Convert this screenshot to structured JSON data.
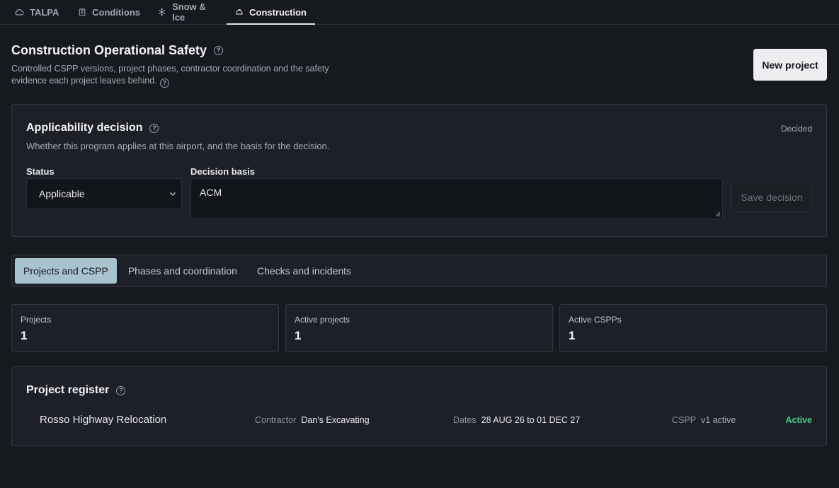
{
  "nav": {
    "tabs": [
      {
        "label": "TALPA",
        "icon": "cloud-icon"
      },
      {
        "label": "Conditions",
        "icon": "clipboard-icon"
      },
      {
        "label": "Snow & Ice",
        "icon": "snowflake-icon"
      },
      {
        "label": "Construction",
        "icon": "hardhat-icon",
        "active": true
      }
    ]
  },
  "header": {
    "title": "Construction Operational Safety",
    "description": "Controlled CSPP versions, project phases, contractor coordination and the safety evidence each project leaves behind.",
    "new_project_label": "New project"
  },
  "applicability": {
    "title": "Applicability decision",
    "state": "Decided",
    "subtitle": "Whether this program applies at this airport, and the basis for the decision.",
    "status_label": "Status",
    "status_value": "Applicable",
    "basis_label": "Decision basis",
    "basis_value": "ACM",
    "save_label": "Save decision"
  },
  "subtabs": [
    {
      "label": "Projects and CSPP",
      "active": true
    },
    {
      "label": "Phases and coordination"
    },
    {
      "label": "Checks and incidents"
    }
  ],
  "stats": [
    {
      "label": "Projects",
      "value": "1"
    },
    {
      "label": "Active projects",
      "value": "1"
    },
    {
      "label": "Active CSPPs",
      "value": "1"
    }
  ],
  "register": {
    "title": "Project register",
    "rows": [
      {
        "name": "Rosso Highway Relocation",
        "contractor_key": "Contractor",
        "contractor": "Dan's Excavating",
        "dates_key": "Dates",
        "dates": "28 AUG 26 to 01 DEC 27",
        "cspp_key": "CSPP",
        "cspp": "v1 active",
        "status": "Active"
      }
    ]
  },
  "colors": {
    "background": "#16191e",
    "card": "#1d2127",
    "accent_tab": "#a9c2cf",
    "status_active": "#3fcf85"
  }
}
